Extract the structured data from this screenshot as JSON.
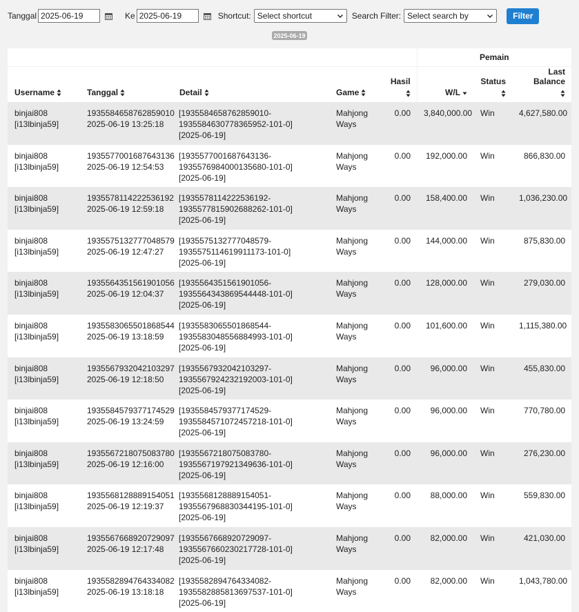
{
  "filters": {
    "tanggal_label": "Tanggal",
    "from_date": "2025-06-19",
    "ke_label": "Ke",
    "to_date": "2025-06-19",
    "shortcut_label": "Shortcut:",
    "shortcut_value": "Select shortcut",
    "search_label": "Search Filter:",
    "search_value": "Select search by",
    "filter_button": "Filter",
    "date_badge": "2025-06-19"
  },
  "table": {
    "group_header": "Pemain",
    "columns": {
      "username": "Username",
      "tanggal": "Tanggal",
      "detail": "Detail",
      "game": "Game",
      "hasil": "Hasil",
      "wl": "W/L",
      "status": "Status",
      "last_balance": "Last Balance"
    },
    "rows": [
      {
        "user": "binjai808",
        "user_id": "[i13lbinja59]",
        "ticket": "1935584658762859010",
        "datetime": "2025-06-19 13:25:18",
        "detail1": "[1935584658762859010-",
        "detail2": "1935584630778365952-101-0]",
        "detail3": "[2025-06-19]",
        "game1": "Mahjong",
        "game2": "Ways",
        "hasil": "0.00",
        "wl": "3,840,000.00",
        "status": "Win",
        "balance": "4,627,580.00"
      },
      {
        "user": "binjai808",
        "user_id": "[i13lbinja59]",
        "ticket": "1935577001687643136",
        "datetime": "2025-06-19 12:54:53",
        "detail1": "[1935577001687643136-",
        "detail2": "1935576984000135680-101-0]",
        "detail3": "[2025-06-19]",
        "game1": "Mahjong",
        "game2": "Ways",
        "hasil": "0.00",
        "wl": "192,000.00",
        "status": "Win",
        "balance": "866,830.00"
      },
      {
        "user": "binjai808",
        "user_id": "[i13lbinja59]",
        "ticket": "1935578114222536192",
        "datetime": "2025-06-19 12:59:18",
        "detail1": "[1935578114222536192-",
        "detail2": "1935577815902688262-101-0]",
        "detail3": "[2025-06-19]",
        "game1": "Mahjong",
        "game2": "Ways",
        "hasil": "0.00",
        "wl": "158,400.00",
        "status": "Win",
        "balance": "1,036,230.00"
      },
      {
        "user": "binjai808",
        "user_id": "[i13lbinja59]",
        "ticket": "1935575132777048579",
        "datetime": "2025-06-19 12:47:27",
        "detail1": "[1935575132777048579-",
        "detail2": "1935575114619911173-101-0]",
        "detail3": "[2025-06-19]",
        "game1": "Mahjong",
        "game2": "Ways",
        "hasil": "0.00",
        "wl": "144,000.00",
        "status": "Win",
        "balance": "875,830.00"
      },
      {
        "user": "binjai808",
        "user_id": "[i13lbinja59]",
        "ticket": "1935564351561901056",
        "datetime": "2025-06-19 12:04:37",
        "detail1": "[1935564351561901056-",
        "detail2": "1935564343869544448-101-0]",
        "detail3": "[2025-06-19]",
        "game1": "Mahjong",
        "game2": "Ways",
        "hasil": "0.00",
        "wl": "128,000.00",
        "status": "Win",
        "balance": "279,030.00"
      },
      {
        "user": "binjai808",
        "user_id": "[i13lbinja59]",
        "ticket": "1935583065501868544",
        "datetime": "2025-06-19 13:18:59",
        "detail1": "[1935583065501868544-",
        "detail2": "1935583048556884993-101-0]",
        "detail3": "[2025-06-19]",
        "game1": "Mahjong",
        "game2": "Ways",
        "hasil": "0.00",
        "wl": "101,600.00",
        "status": "Win",
        "balance": "1,115,380.00"
      },
      {
        "user": "binjai808",
        "user_id": "[i13lbinja59]",
        "ticket": "1935567932042103297",
        "datetime": "2025-06-19 12:18:50",
        "detail1": "[1935567932042103297-",
        "detail2": "1935567924232192003-101-0]",
        "detail3": "[2025-06-19]",
        "game1": "Mahjong",
        "game2": "Ways",
        "hasil": "0.00",
        "wl": "96,000.00",
        "status": "Win",
        "balance": "455,830.00"
      },
      {
        "user": "binjai808",
        "user_id": "[i13lbinja59]",
        "ticket": "1935584579377174529",
        "datetime": "2025-06-19 13:24:59",
        "detail1": "[1935584579377174529-",
        "detail2": "1935584571072457218-101-0]",
        "detail3": "[2025-06-19]",
        "game1": "Mahjong",
        "game2": "Ways",
        "hasil": "0.00",
        "wl": "96,000.00",
        "status": "Win",
        "balance": "770,780.00"
      },
      {
        "user": "binjai808",
        "user_id": "[i13lbinja59]",
        "ticket": "1935567218075083780",
        "datetime": "2025-06-19 12:16:00",
        "detail1": "[1935567218075083780-",
        "detail2": "1935567197921349636-101-0]",
        "detail3": "[2025-06-19]",
        "game1": "Mahjong",
        "game2": "Ways",
        "hasil": "0.00",
        "wl": "96,000.00",
        "status": "Win",
        "balance": "276,230.00"
      },
      {
        "user": "binjai808",
        "user_id": "[i13lbinja59]",
        "ticket": "1935568128889154051",
        "datetime": "2025-06-19 12:19:37",
        "detail1": "[1935568128889154051-",
        "detail2": "1935567968830344195-101-0]",
        "detail3": "[2025-06-19]",
        "game1": "Mahjong",
        "game2": "Ways",
        "hasil": "0.00",
        "wl": "88,000.00",
        "status": "Win",
        "balance": "559,830.00"
      },
      {
        "user": "binjai808",
        "user_id": "[i13lbinja59]",
        "ticket": "1935567668920729097",
        "datetime": "2025-06-19 12:17:48",
        "detail1": "[1935567668920729097-",
        "detail2": "1935567660230217728-101-0]",
        "detail3": "[2025-06-19]",
        "game1": "Mahjong",
        "game2": "Ways",
        "hasil": "0.00",
        "wl": "82,000.00",
        "status": "Win",
        "balance": "421,030.00"
      },
      {
        "user": "binjai808",
        "user_id": "[i13lbinja59]",
        "ticket": "1935582894764334082",
        "datetime": "2025-06-19 13:18:18",
        "detail1": "[1935582894764334082-",
        "detail2": "1935582885813697537-101-0]",
        "detail3": "[2025-06-19]",
        "game1": "Mahjong",
        "game2": "Ways",
        "hasil": "0.00",
        "wl": "82,000.00",
        "status": "Win",
        "balance": "1,043,780.00"
      }
    ]
  },
  "colors": {
    "filter_button": "#1f7fd0",
    "row_stripe": "#e9e9e9",
    "page_background": "#f2f2f2"
  }
}
